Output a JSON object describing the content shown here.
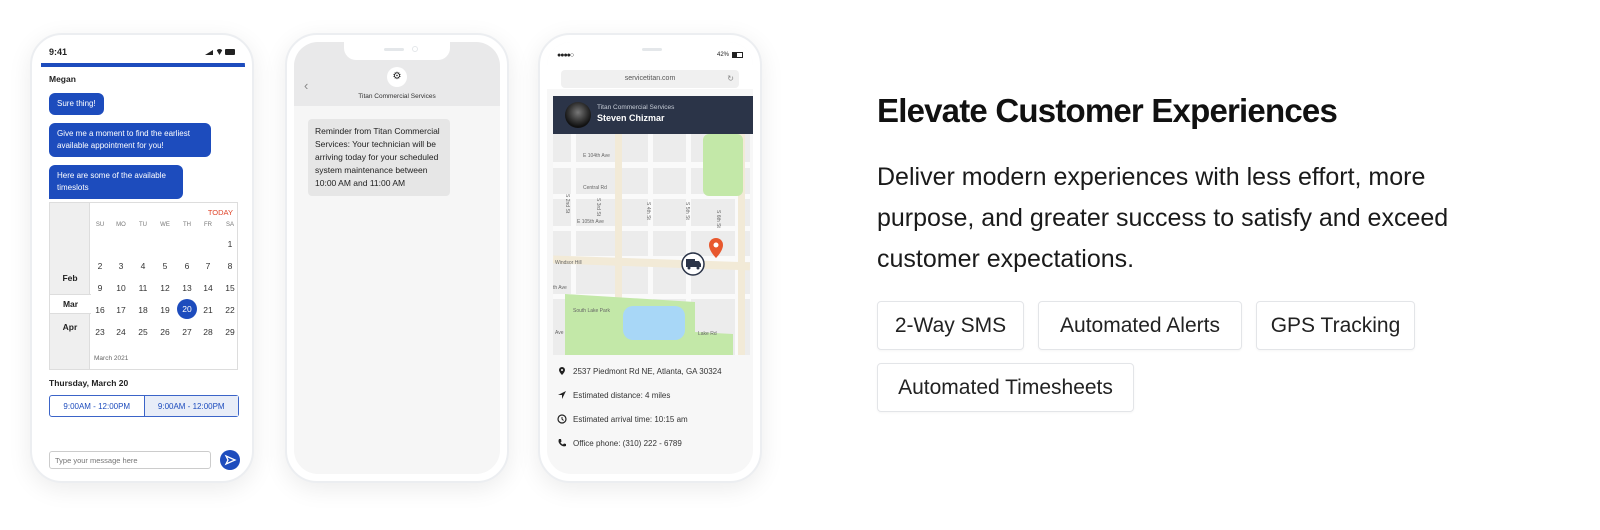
{
  "phone1": {
    "status_time": "9:41",
    "contact": "Megan",
    "messages": [
      "Sure thing!",
      "Give me a moment to find the earliest available appointment for you!",
      "Here are some of the available timeslots"
    ],
    "calendar": {
      "today_label": "TODAY",
      "weekdays": [
        "SU",
        "MO",
        "TU",
        "WE",
        "TH",
        "FR",
        "SA"
      ],
      "months": [
        "Feb",
        "Mar",
        "Apr"
      ],
      "selected_month": "Mar",
      "weeks": [
        [
          "",
          "",
          "",
          "",
          "",
          "",
          "1"
        ],
        [
          "2",
          "3",
          "4",
          "5",
          "6",
          "7",
          "8"
        ],
        [
          "9",
          "10",
          "11",
          "12",
          "13",
          "14",
          "15"
        ],
        [
          "16",
          "17",
          "18",
          "19",
          "20",
          "21",
          "22"
        ],
        [
          "23",
          "24",
          "25",
          "26",
          "27",
          "28",
          "29"
        ]
      ],
      "selected_day": "20",
      "footer": "March 2021"
    },
    "date_label": "Thursday, March 20",
    "timeslots": [
      "9:00AM - 12:00PM",
      "9:00AM - 12:00PM"
    ],
    "input_placeholder": "Type your message here",
    "accent": "#1d4cbd"
  },
  "phone2": {
    "sender": "Titan Commercial Services",
    "message": "Reminder from Titan Commercial Services: Your technician will be arriving today for your scheduled system maintenance between 10:00 AM and 11:00 AM"
  },
  "phone3": {
    "battery": "42%",
    "url": "servicetitan.com",
    "company": "Titan Commercial Services",
    "technician": "Steven Chizmar",
    "map_labels": [
      "E 104th Ave",
      "Central Rd",
      "E 105th Ave",
      "S 2nd St",
      "S 3rd St",
      "S 4th St",
      "S 5th St",
      "S 6th St",
      "Windsor Hill",
      "th Ave",
      "South Lake Park",
      "Ave",
      "Lake Rd"
    ],
    "details": [
      {
        "icon": "location-pin-icon",
        "text": "2537 Piedmont Rd NE, Atlanta, GA 30324"
      },
      {
        "icon": "navigation-arrow-icon",
        "text": "Estimated distance: 4 miles"
      },
      {
        "icon": "clock-icon",
        "text": "Estimated arrival time: 10:15 am"
      },
      {
        "icon": "phone-icon",
        "text": "Office phone: (310) 222 - 6789"
      }
    ]
  },
  "hero": {
    "title": "Elevate Customer Experiences",
    "description": "Deliver modern experiences with less effort, more purpose, and greater success to satisfy and exceed customer expectations.",
    "features": [
      "2-Way SMS",
      "Automated Alerts",
      "GPS Tracking",
      "Automated Timesheets"
    ]
  }
}
